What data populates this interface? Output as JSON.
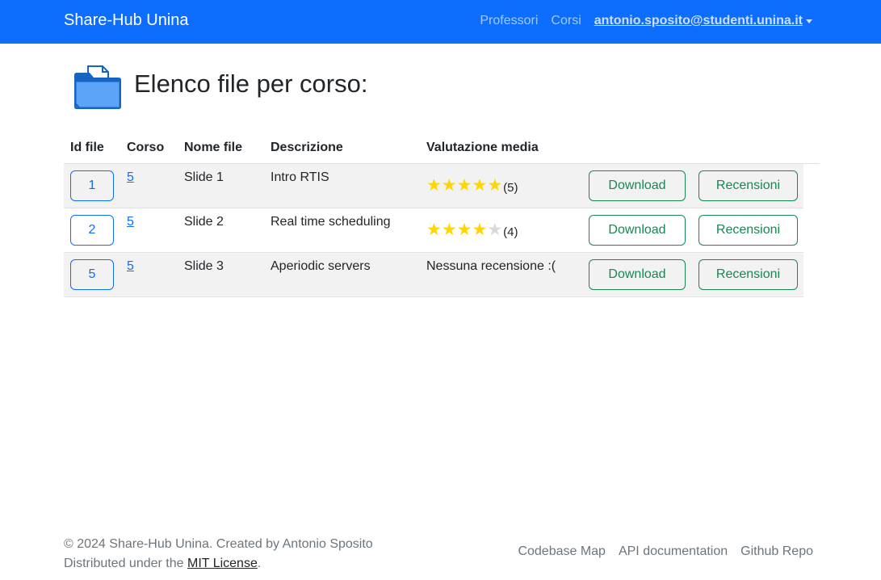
{
  "navbar": {
    "brand": "Share-Hub Unina",
    "links": [
      "Professori",
      "Corsi"
    ],
    "user": "antonio.sposito@studenti.unina.it",
    "color": "#0d6efd"
  },
  "page": {
    "title": "Elenco file per corso:",
    "icon": "folder-icon"
  },
  "table": {
    "headers": [
      "Id file",
      "Corso",
      "Nome file",
      "Descrizione",
      "Valutazione media"
    ],
    "rows": [
      {
        "id": "1",
        "course": "5",
        "name": "Slide 1",
        "description": "Intro RTIS",
        "rating": 5,
        "rating_label": "(5)",
        "no_review": "",
        "download": "Download",
        "reviews": "Recensioni"
      },
      {
        "id": "2",
        "course": "5",
        "name": "Slide 2",
        "description": "Real time scheduling",
        "rating": 4,
        "rating_label": "(4)",
        "no_review": "",
        "download": "Download",
        "reviews": "Recensioni"
      },
      {
        "id": "5",
        "course": "5",
        "name": "Slide 3",
        "description": "Aperiodic servers",
        "rating": null,
        "rating_label": "",
        "no_review": "Nessuna recensione :(",
        "download": "Download",
        "reviews": "Recensioni"
      }
    ],
    "star_color": "#ffd700",
    "max_stars": 5
  },
  "footer": {
    "copyright": "© 2024 Share-Hub Unina. Created by Antonio Sposito",
    "license_prefix": "Distributed under the ",
    "license_link": "MIT License",
    "license_suffix": ".",
    "links": [
      "Codebase Map",
      "API documentation",
      "Github Repo"
    ]
  }
}
